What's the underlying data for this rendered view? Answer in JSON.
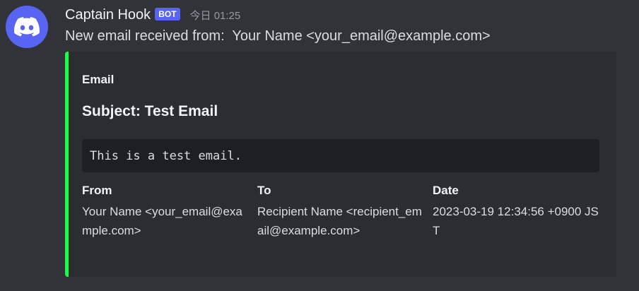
{
  "author": {
    "name": "Captain Hook",
    "tag": "BOT",
    "timestamp": "今日 01:25",
    "avatar_icon": "discord-logo-icon",
    "avatar_color": "#5865f2"
  },
  "message": {
    "content": "New email received from:  Your Name <your_email@example.com>"
  },
  "embed": {
    "accent_color": "#15ff4a",
    "author": "Email",
    "title": "Subject: Test Email",
    "description": "This is a test email.",
    "fields": [
      {
        "name": "From",
        "value": "Your Name <your_email@example.com>"
      },
      {
        "name": "To",
        "value": "Recipient Name <recipient_email@example.com>"
      },
      {
        "name": "Date",
        "value": "2023-03-19 12:34:56 +0900 JST"
      }
    ]
  }
}
